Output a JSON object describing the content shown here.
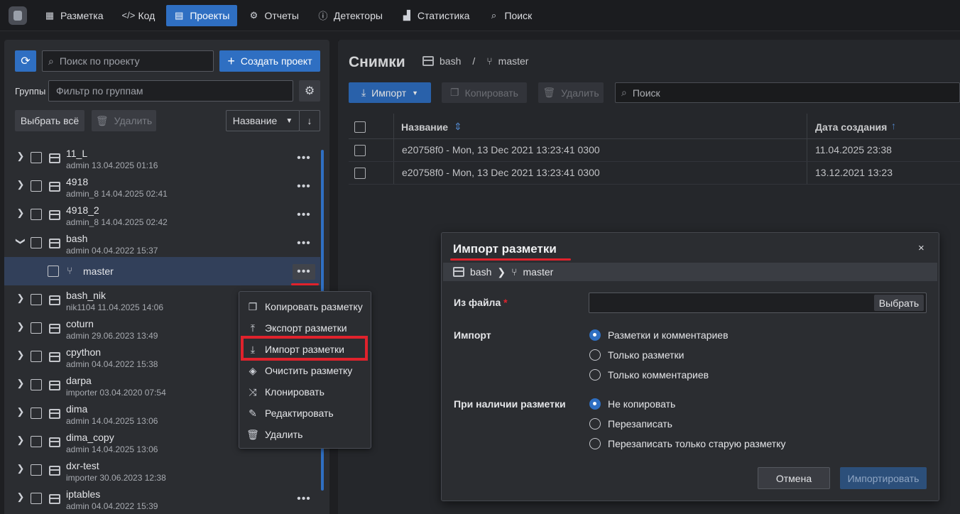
{
  "nav": {
    "items": [
      {
        "label": "Разметка",
        "icon": "markup-icon"
      },
      {
        "label": "Код",
        "icon": "code-icon"
      },
      {
        "label": "Проекты",
        "icon": "projects-icon",
        "active": true
      },
      {
        "label": "Отчеты",
        "icon": "reports-icon"
      },
      {
        "label": "Детекторы",
        "icon": "detectors-icon"
      },
      {
        "label": "Статистика",
        "icon": "statistics-icon"
      },
      {
        "label": "Поиск",
        "icon": "search-icon"
      }
    ]
  },
  "sidebar": {
    "search_placeholder": "Поиск по проекту",
    "create_label": "Создать проект",
    "groups_label": "Группы",
    "groups_placeholder": "Фильтр по группам",
    "select_all_label": "Выбрать всё",
    "delete_label": "Удалить",
    "sort_label": "Название",
    "projects": [
      {
        "name": "11_L",
        "meta": "admin 13.04.2025 01:16"
      },
      {
        "name": "4918",
        "meta": "admin_8 14.04.2025 02:41"
      },
      {
        "name": "4918_2",
        "meta": "admin_8 14.04.2025 02:42"
      },
      {
        "name": "bash",
        "meta": "admin 04.04.2022 15:37",
        "expanded": true
      },
      {
        "name": "bash_nik",
        "meta": "nik1104 11.04.2025 14:06"
      },
      {
        "name": "coturn",
        "meta": "admin 29.06.2023 13:49"
      },
      {
        "name": "cpython",
        "meta": "admin 04.04.2022 15:38"
      },
      {
        "name": "darpa",
        "meta": "importer 03.04.2020 07:54"
      },
      {
        "name": "dima",
        "meta": "admin 14.04.2025 13:06"
      },
      {
        "name": "dima_copy",
        "meta": "admin 14.04.2025 13:06"
      },
      {
        "name": "dxr-test",
        "meta": "importer 30.06.2023 12:38"
      },
      {
        "name": "iptables",
        "meta": "admin 04.04.2022 15:39"
      }
    ],
    "branch": {
      "name": "master"
    }
  },
  "context_menu": {
    "items": [
      {
        "label": "Копировать разметку",
        "icon": "copy-icon"
      },
      {
        "label": "Экспорт разметки",
        "icon": "export-icon"
      },
      {
        "label": "Импорт разметки",
        "icon": "import-icon"
      },
      {
        "label": "Очистить разметку",
        "icon": "eraser-icon"
      },
      {
        "label": "Клонировать",
        "icon": "clone-icon"
      },
      {
        "label": "Редактировать",
        "icon": "pencil-icon"
      },
      {
        "label": "Удалить",
        "icon": "trash-icon"
      }
    ]
  },
  "snapshots": {
    "title": "Снимки",
    "project": "bash",
    "separator": "/",
    "branch": "master",
    "import_label": "Импорт",
    "copy_label": "Копировать",
    "delete_label": "Удалить",
    "search_placeholder": "Поиск",
    "columns": {
      "name": "Название",
      "created": "Дата создания"
    },
    "rows": [
      {
        "name": "e20758f0 - Mon, 13 Dec 2021 13:23:41 0300",
        "created": "11.04.2025 23:38"
      },
      {
        "name": "e20758f0 - Mon, 13 Dec 2021 13:23:41 0300",
        "created": "13.12.2021 13:23"
      }
    ]
  },
  "dialog": {
    "title": "Импорт разметки",
    "close": "×",
    "crumb_project": "bash",
    "crumb_branch": "master",
    "from_file_label": "Из файла",
    "required_mark": "*",
    "choose_label": "Выбрать",
    "import_label": "Импорт",
    "import_options": [
      "Разметки и комментариев",
      "Только разметки",
      "Только комментариев"
    ],
    "import_selected": 0,
    "existing_label": "При наличии разметки",
    "existing_options": [
      "Не копировать",
      "Перезаписать",
      "Перезаписать только старую разметку"
    ],
    "existing_selected": 0,
    "cancel_label": "Отмена",
    "submit_label": "Импортировать"
  },
  "colors": {
    "accent": "#2f6fc2",
    "highlight": "#e0222c",
    "panel": "#2b2d31",
    "background": "#1e1f22"
  }
}
